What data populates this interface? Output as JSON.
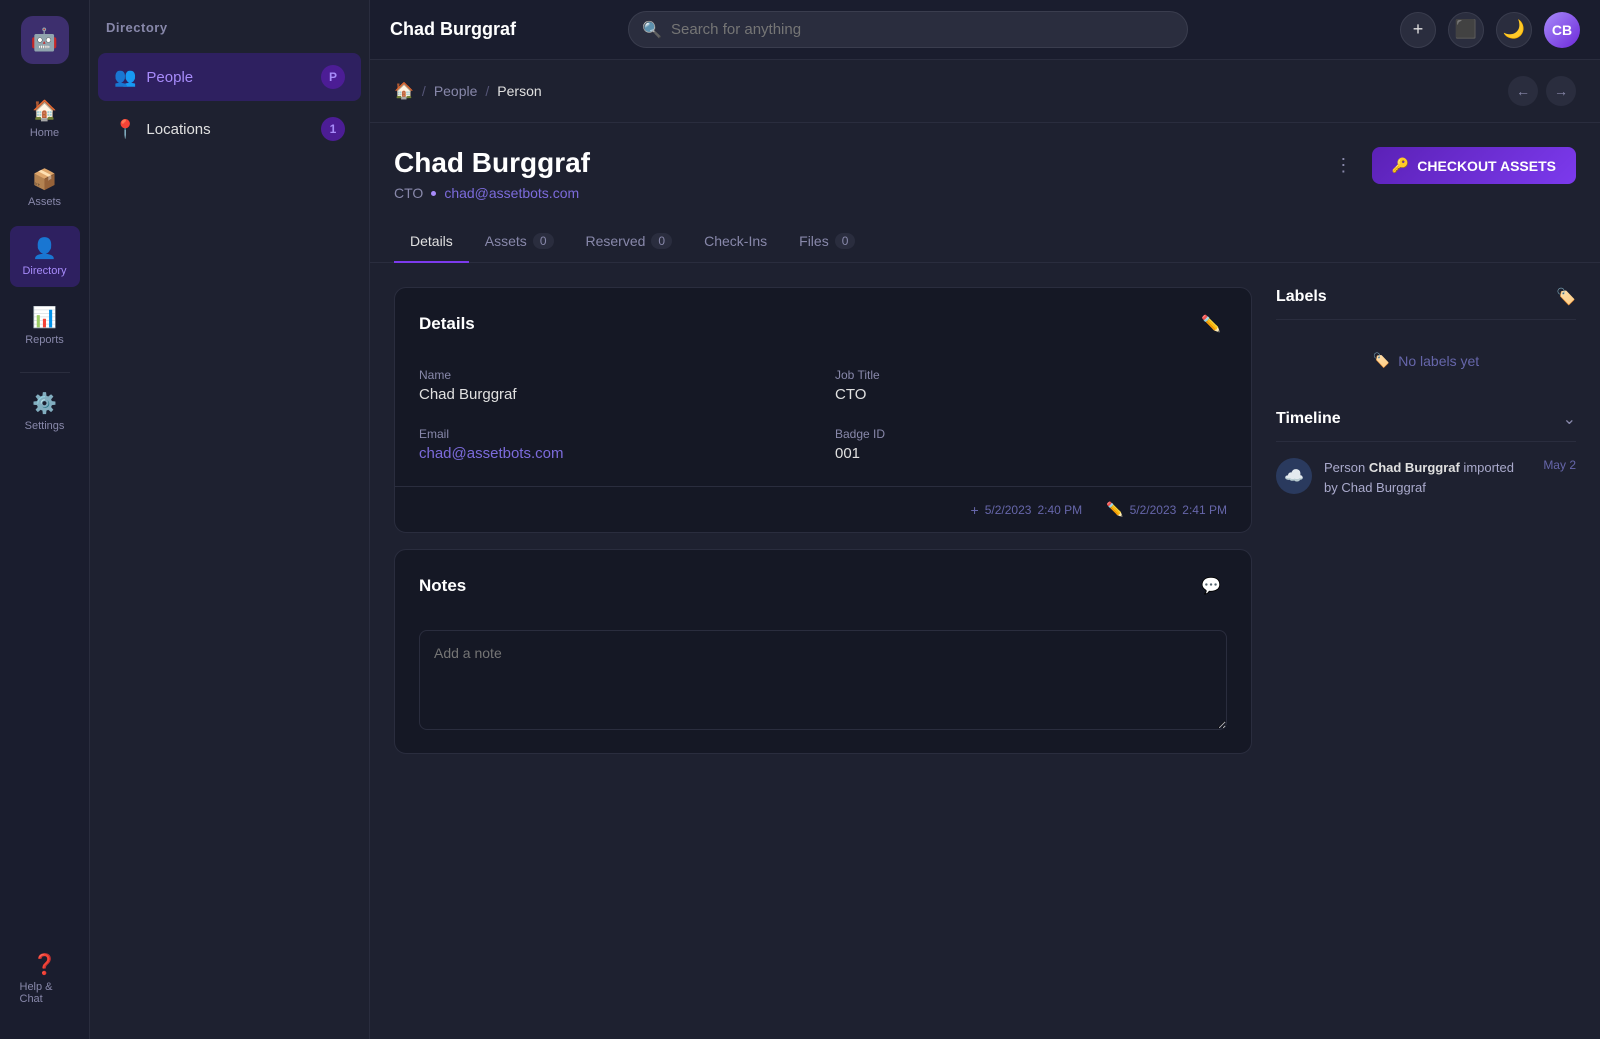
{
  "app": {
    "logo": "🤖",
    "title": "Chad Burggraf"
  },
  "sidebar_nav": {
    "items": [
      {
        "id": "home",
        "label": "Home",
        "icon": "🏠",
        "active": false
      },
      {
        "id": "assets",
        "label": "Assets",
        "icon": "📦",
        "active": false
      },
      {
        "id": "directory",
        "label": "Directory",
        "icon": "👤",
        "active": true
      },
      {
        "id": "reports",
        "label": "Reports",
        "icon": "📊",
        "active": false
      },
      {
        "id": "settings",
        "label": "Settings",
        "icon": "⚙️",
        "active": false
      }
    ],
    "bottom": {
      "label": "Help & Chat",
      "icon": "❓"
    }
  },
  "directory_sidebar": {
    "header": "Directory",
    "items": [
      {
        "id": "people",
        "label": "People",
        "icon": "👥",
        "badge": "P",
        "active": true
      },
      {
        "id": "locations",
        "label": "Locations",
        "icon": "📍",
        "badge": "1",
        "active": false
      }
    ]
  },
  "topbar": {
    "search_placeholder": "Search for anything",
    "add_icon": "+",
    "scan_icon": "⬛",
    "moon_icon": "🌙"
  },
  "breadcrumb": {
    "home_icon": "🏠",
    "people": "People",
    "person": "Person",
    "back_icon": "←",
    "forward_icon": "→"
  },
  "person": {
    "name": "Chad Burggraf",
    "role": "CTO",
    "email": "chad@assetbots.com"
  },
  "checkout_button": "CHECKOUT ASSETS",
  "tabs": [
    {
      "id": "details",
      "label": "Details",
      "badge": null,
      "active": true
    },
    {
      "id": "assets",
      "label": "Assets",
      "badge": "0",
      "active": false
    },
    {
      "id": "reserved",
      "label": "Reserved",
      "badge": "0",
      "active": false
    },
    {
      "id": "checkins",
      "label": "Check-Ins",
      "badge": null,
      "active": false
    },
    {
      "id": "files",
      "label": "Files",
      "badge": "0",
      "active": false
    }
  ],
  "details_card": {
    "title": "Details",
    "fields": {
      "name_label": "Name",
      "name_value": "Chad Burggraf",
      "job_title_label": "Job Title",
      "job_title_value": "CTO",
      "email_label": "Email",
      "email_value": "chad@assetbots.com",
      "badge_id_label": "Badge ID",
      "badge_id_value": "001"
    },
    "footer": {
      "created_icon": "+",
      "created_date": "5/2/2023",
      "created_time": "2:40 PM",
      "edited_icon": "✏️",
      "edited_date": "5/2/2023",
      "edited_time": "2:41 PM"
    }
  },
  "notes_card": {
    "title": "Notes",
    "placeholder": "Add a note",
    "add_icon": "💬"
  },
  "labels_panel": {
    "title": "Labels",
    "no_labels_text": "No labels yet",
    "tag_icon": "🏷️"
  },
  "timeline_panel": {
    "title": "Timeline",
    "items": [
      {
        "icon": "☁️",
        "text_before": "Person ",
        "text_bold": "Chad Burggraf",
        "text_after": " imported by Chad Burggraf",
        "date": "May 2"
      }
    ]
  }
}
